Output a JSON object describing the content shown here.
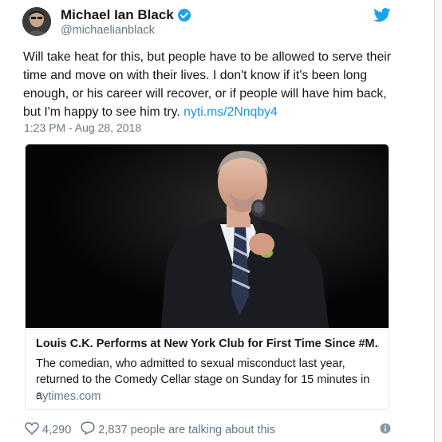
{
  "author": {
    "display_name": "Michael Ian Black",
    "handle": "@michaelianblack",
    "verified": true
  },
  "tweet": {
    "text_before_link": "Will take heat for this, but people have to be allowed to serve their time and move on with their lives. I don't know if it's been long enough, or his career will recover, or if people will have him back, but I'm happy to see him try. ",
    "link_text": "nyti.ms/2Nnqby4",
    "timestamp": "1:23 PM - Aug 28, 2018"
  },
  "card": {
    "title": "Louis C.K. Performs at New York Club for First Time Since #M...",
    "description": "The comedian, who admitted to sexual misconduct last year, returned to the Comedy Cellar stage on Sunday for 15 minutes in a",
    "domain": "nytimes.com"
  },
  "actions": {
    "likes": "4,290",
    "talking": "2,837 people are talking about this"
  },
  "colors": {
    "link": "#1b95e0",
    "twitter_blue": "#1da1f2",
    "secondary_text": "#657786"
  },
  "icons": [
    "verified-badge-icon",
    "twitter-bird-icon",
    "heart-icon",
    "comment-icon",
    "info-icon"
  ]
}
